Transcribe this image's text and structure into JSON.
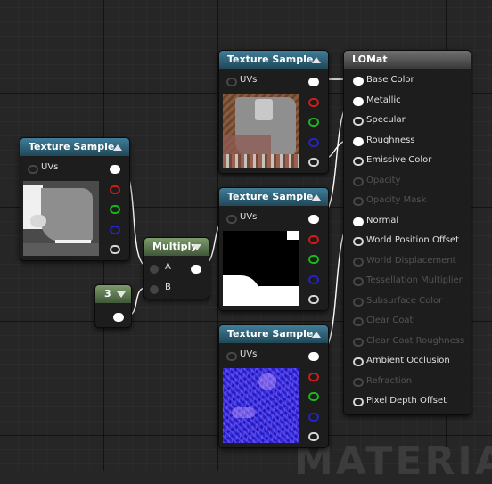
{
  "graph": {
    "watermark": "MATERIA"
  },
  "nodes": {
    "tex1": {
      "title": "Texture Sample",
      "uv_label": "UVs"
    },
    "tex2": {
      "title": "Texture Sample",
      "uv_label": "UVs"
    },
    "tex3": {
      "title": "Texture Sample",
      "uv_label": "UVs"
    },
    "tex4": {
      "title": "Texture Sample",
      "uv_label": "UVs"
    },
    "multiply": {
      "title": "Multiply",
      "input_a": "A",
      "input_b": "B"
    },
    "constant": {
      "value": "3"
    },
    "material": {
      "title": "LOMat",
      "inputs": [
        {
          "label": "Base Color",
          "enabled": true,
          "connected": true
        },
        {
          "label": "Metallic",
          "enabled": true,
          "connected": true
        },
        {
          "label": "Specular",
          "enabled": true,
          "connected": false
        },
        {
          "label": "Roughness",
          "enabled": true,
          "connected": true
        },
        {
          "label": "Emissive Color",
          "enabled": true,
          "connected": false
        },
        {
          "label": "Opacity",
          "enabled": false,
          "connected": false
        },
        {
          "label": "Opacity Mask",
          "enabled": false,
          "connected": false
        },
        {
          "label": "Normal",
          "enabled": true,
          "connected": true
        },
        {
          "label": "World Position Offset",
          "enabled": true,
          "connected": false
        },
        {
          "label": "World Displacement",
          "enabled": false,
          "connected": false
        },
        {
          "label": "Tessellation Multiplier",
          "enabled": false,
          "connected": false
        },
        {
          "label": "Subsurface Color",
          "enabled": false,
          "connected": false
        },
        {
          "label": "Clear Coat",
          "enabled": false,
          "connected": false
        },
        {
          "label": "Clear Coat Roughness",
          "enabled": false,
          "connected": false
        },
        {
          "label": "Ambient Occlusion",
          "enabled": true,
          "connected": false
        },
        {
          "label": "Refraction",
          "enabled": false,
          "connected": false
        },
        {
          "label": "Pixel Depth Offset",
          "enabled": true,
          "connected": false
        }
      ]
    }
  },
  "colors": {
    "header_texture": "#2f6a82",
    "header_math": "#5e7a50",
    "header_result": "#555555",
    "pin_red": "#d11a1a",
    "pin_green": "#1bb61b",
    "pin_blue": "#2424c8",
    "wire": "#ffffff"
  }
}
